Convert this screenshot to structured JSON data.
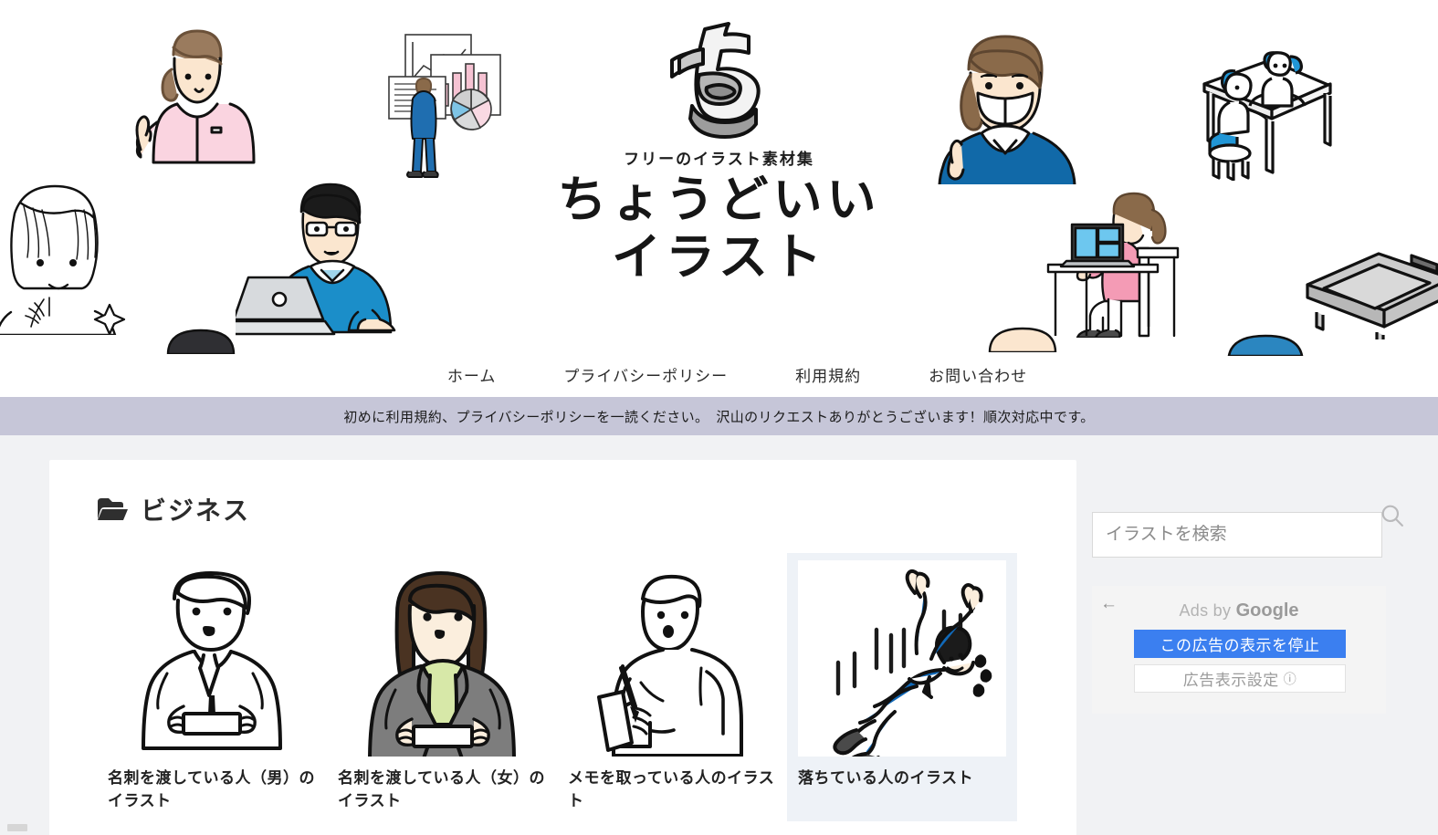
{
  "site": {
    "logo_mark": "chi-character-logo",
    "tagline": "フリーのイラスト素材集",
    "title_line1": "ちょうどいい",
    "title_line2": "イラスト"
  },
  "nav": {
    "items": [
      {
        "label": "ホーム",
        "name": "nav-home"
      },
      {
        "label": "プライバシーポリシー",
        "name": "nav-privacy-policy"
      },
      {
        "label": "利用規約",
        "name": "nav-terms"
      },
      {
        "label": "お問い合わせ",
        "name": "nav-contact"
      }
    ]
  },
  "notice": {
    "text": "初めに利用規約、プライバシーポリシーを一読ください。　沢山のリクエストありがとうございます！順次対応中です。"
  },
  "category": {
    "icon": "folder-open-icon",
    "label": "ビジネス"
  },
  "illustrations": [
    {
      "caption": "名刺を渡している人（男）のイラスト",
      "art": "businessman-business-card",
      "active": false
    },
    {
      "caption": "名刺を渡している人（女）のイラスト",
      "art": "businesswoman-business-card",
      "active": false
    },
    {
      "caption": "メモを取っている人のイラスト",
      "art": "person-taking-memo",
      "active": false
    },
    {
      "caption": "落ちている人のイラスト",
      "art": "falling-person",
      "active": true
    }
  ],
  "search": {
    "placeholder": "イラストを検索",
    "value": "",
    "icon": "search-icon"
  },
  "ad": {
    "back_icon": "←",
    "byline_prefix": "Ads by",
    "byline_brand": "Google",
    "stop_label": "この広告の表示を停止",
    "settings_label": "広告表示設定",
    "settings_info_icon": "ⓘ",
    "accent_color": "#3b7ff0"
  },
  "colors": {
    "notice_bar": "#c6c6d8",
    "page_bg": "#f1f2f4",
    "card_bg": "#ffffff",
    "tile_active_bg": "#eef2f7",
    "blue_accent": "#1b7fc4",
    "pink_accent": "#f7c9d6"
  }
}
